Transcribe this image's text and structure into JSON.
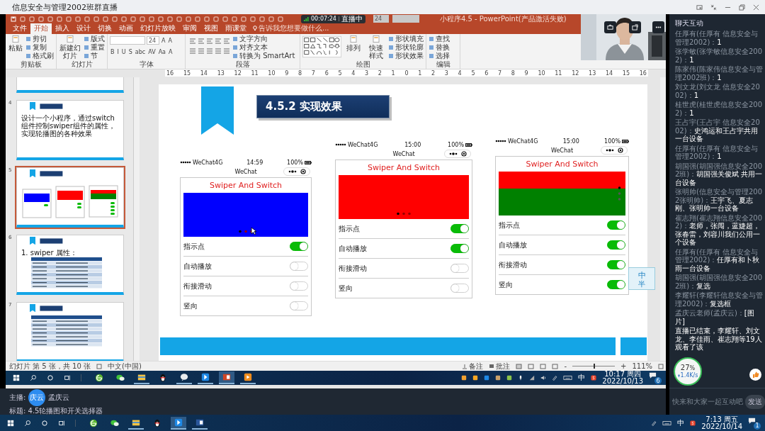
{
  "window": {
    "title": "信息安全与管理2002班群直播"
  },
  "live_badge": {
    "time": "00:07:24",
    "status": "直播中"
  },
  "powerpoint": {
    "title": "小程序4.5 - PowerPoint(产品激活失败)",
    "qat_font_size": "24",
    "tabs": [
      {
        "label": "文件",
        "selected": false
      },
      {
        "label": "开始",
        "selected": true
      },
      {
        "label": "插入",
        "selected": false
      },
      {
        "label": "设计",
        "selected": false
      },
      {
        "label": "切换",
        "selected": false
      },
      {
        "label": "动画",
        "selected": false
      },
      {
        "label": "幻灯片放映",
        "selected": false
      },
      {
        "label": "审阅",
        "selected": false
      },
      {
        "label": "视图",
        "selected": false
      },
      {
        "label": "雨课堂",
        "selected": false
      }
    ],
    "tell_me": "告诉我您想要做什么...",
    "ribbon_groups": [
      {
        "label": "剪贴板",
        "items": [
          {
            "kind": "big",
            "label": "粘贴"
          },
          {
            "kind": "small",
            "label": "剪切"
          },
          {
            "kind": "small",
            "label": "复制"
          },
          {
            "kind": "small",
            "label": "格式刷"
          }
        ]
      },
      {
        "label": "幻灯片",
        "items": [
          {
            "kind": "big",
            "label": "新建幻灯片"
          },
          {
            "kind": "small",
            "label": "版式"
          },
          {
            "kind": "small",
            "label": "重置"
          },
          {
            "kind": "small",
            "label": "节"
          }
        ]
      },
      {
        "label": "字体",
        "items": [
          {
            "kind": "font"
          },
          {
            "kind": "row",
            "items": [
              "B",
              "I",
              "U",
              "S",
              "abc",
              "AV",
              "Aa",
              "A"
            ]
          }
        ],
        "font_size": "24",
        "grow": "A",
        "shrink": "A"
      },
      {
        "label": "段落",
        "items": [
          {
            "kind": "align"
          },
          {
            "kind": "small",
            "label": "文字方向"
          },
          {
            "kind": "small",
            "label": "对齐文本"
          },
          {
            "kind": "small",
            "label": "转换为 SmartArt"
          }
        ]
      },
      {
        "label": "绘图",
        "items": [
          {
            "kind": "gallery"
          },
          {
            "kind": "big",
            "label": "排列"
          },
          {
            "kind": "big",
            "label": "快速样式"
          },
          {
            "kind": "small",
            "label": "形状填充"
          },
          {
            "kind": "small",
            "label": "形状轮廓"
          },
          {
            "kind": "small",
            "label": "形状效果"
          }
        ]
      },
      {
        "label": "编辑",
        "items": [
          {
            "kind": "small",
            "label": "查找"
          },
          {
            "kind": "small",
            "label": "替换"
          },
          {
            "kind": "small",
            "label": "选择"
          }
        ]
      }
    ],
    "ruler": [
      "16",
      "15",
      "14",
      "13",
      "12",
      "11",
      "10",
      "9",
      "8",
      "7",
      "6",
      "5",
      "4",
      "3",
      "2",
      "1",
      "0",
      "1",
      "2",
      "3",
      "4",
      "5",
      "6",
      "7",
      "8",
      "9",
      "10",
      "11",
      "12",
      "13",
      "14",
      "15",
      "16"
    ],
    "thumbnails": [
      {
        "number": "4",
        "selected": false,
        "kind": "text",
        "text": "设计一个小程序，通过switch组件控制swiper组件的属性，实现轮播图的各种效果"
      },
      {
        "number": "5",
        "selected": true,
        "kind": "preview"
      },
      {
        "number": "6",
        "selected": false,
        "kind": "table",
        "text": "1. swiper 属性："
      },
      {
        "number": "7",
        "selected": false,
        "kind": "table"
      }
    ],
    "slide": {
      "title": "4.5.2 实现效果",
      "phones": [
        {
          "carrier": "WeChat4G",
          "time": "14:59",
          "battery": "100%",
          "nav_title": "WeChat",
          "heading": "Swiper And Switch",
          "swiper_slides": [
            {
              "color": "#0000ff"
            }
          ],
          "switches": [
            {
              "label": "指示点",
              "on": true
            },
            {
              "label": "自动播放",
              "on": false
            },
            {
              "label": "衔接滑动",
              "on": false
            },
            {
              "label": "竖向",
              "on": false
            }
          ]
        },
        {
          "carrier": "WeChat4G",
          "time": "15:00",
          "battery": "100%",
          "nav_title": "WeChat",
          "heading": "Swiper And Switch",
          "swiper_slides": [
            {
              "color": "#ff0000"
            }
          ],
          "switches": [
            {
              "label": "指示点",
              "on": true
            },
            {
              "label": "自动播放",
              "on": true
            },
            {
              "label": "衔接滑动",
              "on": false
            },
            {
              "label": "竖向",
              "on": false
            }
          ]
        },
        {
          "carrier": "WeChat4G",
          "time": "15:00",
          "battery": "100%",
          "nav_title": "WeChat",
          "heading": "Swiper And Switch",
          "swiper_slides": [
            {
              "color": "#ff0000"
            },
            {
              "color": "#008000"
            }
          ],
          "switches": [
            {
              "label": "指示点",
              "on": true
            },
            {
              "label": "自动播放",
              "on": true
            },
            {
              "label": "衔接滑动",
              "on": true
            },
            {
              "label": "竖向",
              "on": true
            }
          ]
        }
      ]
    },
    "ime_float": {
      "main": "中",
      "sub": "半"
    },
    "status": {
      "slide_info": "幻灯片 第 5 张，共 10 张",
      "language": "中文(中国)",
      "notes": "备注",
      "comments": "批注",
      "zoom_out": "-",
      "zoom_in": "+",
      "zoom_slider": {
        "level": 0.5
      },
      "zoom": "111%"
    },
    "taskbar": {
      "apps": [
        {
          "kind": "browser",
          "running": false,
          "active": false
        },
        {
          "kind": "wechat",
          "running": false,
          "active": false
        },
        {
          "kind": "folder",
          "running": true,
          "active": false
        },
        {
          "kind": "penguin",
          "running": false,
          "active": false
        },
        {
          "kind": "bubble",
          "running": true,
          "active": false
        },
        {
          "kind": "arrow",
          "running": true,
          "active": false
        },
        {
          "kind": "slides",
          "running": true,
          "active": true
        },
        {
          "kind": "video",
          "running": true,
          "active": false
        }
      ],
      "ime": "中",
      "time": "10:17 周四",
      "date": "2022/10/13",
      "notifications": "6"
    }
  },
  "stream": {
    "host_label": "主播:",
    "avatar": "庆云",
    "host": "孟庆云",
    "title": "标题: 4.5轮播图和开关选择器"
  },
  "chat": {
    "title": "聊天互动",
    "messages": [
      {
        "sender": "任厚有(任厚有 信息安全与管理2002)：",
        "text": "1"
      },
      {
        "sender": "张学敏(张学敏信息安全2002)：",
        "text": "1"
      },
      {
        "sender": "陈家伟(陈家伟信息安全与管理2002班)：",
        "text": "1"
      },
      {
        "sender": "刘文龙(刘文龙 信息安全2002)：",
        "text": "1"
      },
      {
        "sender": "桂世虎(桂世虎信息安全2002)：",
        "text": "1"
      },
      {
        "sender": "王占宇(王占宇 信息安全2002)：",
        "text": "史鸿运和王占宇共用一台设备"
      },
      {
        "sender": "任厚有(任厚有 信息安全与管理2002)：",
        "text": "1"
      },
      {
        "sender": "胡国强(胡国强信息安全2002班)：",
        "text": "胡国强关俊斌 共用一台设备"
      },
      {
        "sender": "张明帅(信息安全与管理2002张明帅)：",
        "text": "王宇飞、夏志刚、张明帅一台设备"
      },
      {
        "sender": "崔志翔(崔志翔信息安全2002)：",
        "text": "老师，张闯，蓝婕超，张春雷，刘容川我们公用一个设备"
      },
      {
        "sender": "任厚有(任厚有 信息安全与管理2002)：",
        "text": "任厚有和卜秋雨一台设备"
      },
      {
        "sender": "胡国强(胡国强信息安全2002班)：",
        "text": "复选"
      },
      {
        "sender": "李耀轩(李耀轩信息安全与管理2002)：",
        "text": "复选框"
      },
      {
        "sender": "孟庆云老师(孟庆云)：",
        "text": "[图片]"
      }
    ],
    "notice": "直播已结束，李耀轩、刘文龙、李佳雨、崔志翔等19人观看了该",
    "placeholder": "快来和大家一起互动吧",
    "send": "发送"
  },
  "net_meter": {
    "percent": "27",
    "unit": "%",
    "speed": "1.4K/s"
  },
  "taskbar": {
    "apps": [
      {
        "kind": "browser",
        "running": false,
        "active": false
      },
      {
        "kind": "wechat",
        "running": false,
        "active": false
      },
      {
        "kind": "folder",
        "running": true,
        "active": false
      },
      {
        "kind": "penguin",
        "running": false,
        "active": false
      },
      {
        "kind": "arrow",
        "running": true,
        "active": true
      },
      {
        "kind": "document",
        "running": true,
        "active": false
      }
    ],
    "ime": "中",
    "time": "7:13 周五",
    "date": "2022/10/14",
    "notifications": "1"
  }
}
